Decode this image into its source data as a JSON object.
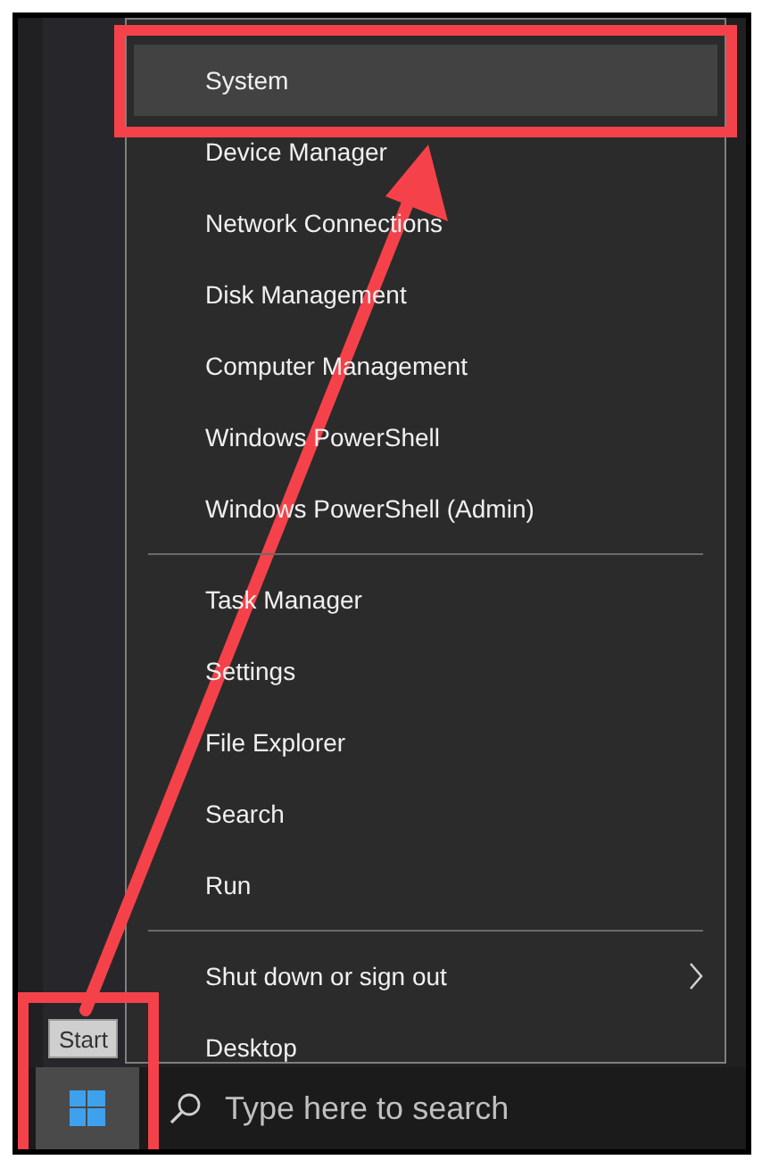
{
  "menu": {
    "items": [
      {
        "kind": "item",
        "label": "System",
        "selected": true
      },
      {
        "kind": "item",
        "label": "Device Manager",
        "selected": false
      },
      {
        "kind": "item",
        "label": "Network Connections",
        "selected": false
      },
      {
        "kind": "item",
        "label": "Disk Management",
        "selected": false
      },
      {
        "kind": "item",
        "label": "Computer Management",
        "selected": false
      },
      {
        "kind": "item",
        "label": "Windows PowerShell",
        "selected": false
      },
      {
        "kind": "item",
        "label": "Windows PowerShell (Admin)",
        "selected": false
      },
      {
        "kind": "separator"
      },
      {
        "kind": "item",
        "label": "Task Manager",
        "selected": false
      },
      {
        "kind": "item",
        "label": "Settings",
        "selected": false
      },
      {
        "kind": "item",
        "label": "File Explorer",
        "selected": false
      },
      {
        "kind": "item",
        "label": "Search",
        "selected": false
      },
      {
        "kind": "item",
        "label": "Run",
        "selected": false
      },
      {
        "kind": "separator"
      },
      {
        "kind": "submenu",
        "label": "Shut down or sign out",
        "selected": false
      },
      {
        "kind": "item",
        "label": "Desktop",
        "selected": false
      }
    ]
  },
  "tooltip": "Start",
  "taskbar": {
    "search": {
      "placeholder": "Type here to search"
    }
  }
}
